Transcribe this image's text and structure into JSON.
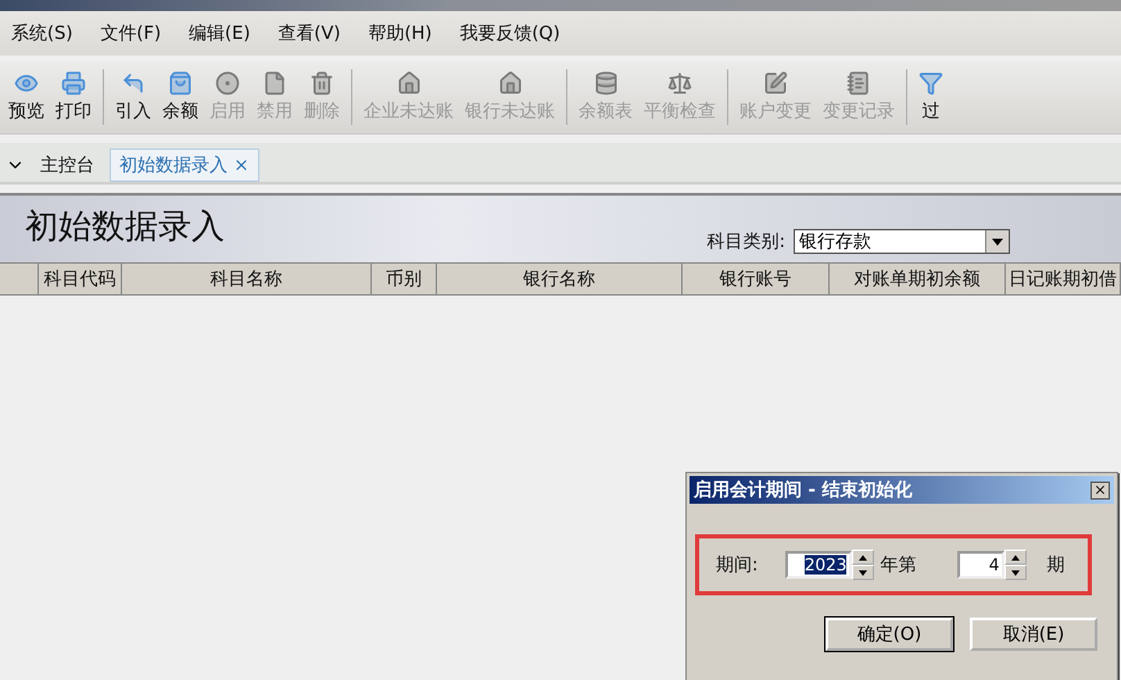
{
  "menu": [
    "系统(S)",
    "文件(F)",
    "编辑(E)",
    "查看(V)",
    "帮助(H)",
    "我要反馈(Q)"
  ],
  "toolbar": [
    {
      "label": "预览",
      "disabled": false,
      "separator_before": false
    },
    {
      "label": "打印",
      "disabled": false,
      "separator_before": false
    },
    {
      "label": "引入",
      "disabled": false,
      "separator_before": true
    },
    {
      "label": "余额",
      "disabled": false,
      "separator_before": false
    },
    {
      "label": "启用",
      "disabled": true,
      "separator_before": false
    },
    {
      "label": "禁用",
      "disabled": true,
      "separator_before": false
    },
    {
      "label": "删除",
      "disabled": true,
      "separator_before": false
    },
    {
      "label": "企业未达账",
      "disabled": true,
      "separator_before": true
    },
    {
      "label": "银行未达账",
      "disabled": true,
      "separator_before": false
    },
    {
      "label": "余额表",
      "disabled": true,
      "separator_before": true
    },
    {
      "label": "平衡检查",
      "disabled": true,
      "separator_before": false
    },
    {
      "label": "账户变更",
      "disabled": true,
      "separator_before": true
    },
    {
      "label": "变更记录",
      "disabled": true,
      "separator_before": false
    },
    {
      "label": "过",
      "disabled": false,
      "separator_before": true
    }
  ],
  "tabs": [
    {
      "label": "主控台",
      "selected": false,
      "closable": false
    },
    {
      "label": "初始数据录入",
      "selected": true,
      "closable": true
    }
  ],
  "banner": {
    "title": "初始数据录入",
    "category_label": "科目类别:",
    "category_value": "银行存款"
  },
  "table": {
    "columns": [
      "",
      "科目代码",
      "科目名称",
      "币别",
      "银行名称",
      "银行账号",
      "对账单期初余额",
      "日记账期初借"
    ]
  },
  "dialog": {
    "title": "启用会计期间 - 结束初始化",
    "period_label": "期间:",
    "year": "2023",
    "year_suffix": "年第",
    "period": "4",
    "period_suffix": "期",
    "buttons": [
      "确定(O)",
      "取消(E)"
    ]
  }
}
